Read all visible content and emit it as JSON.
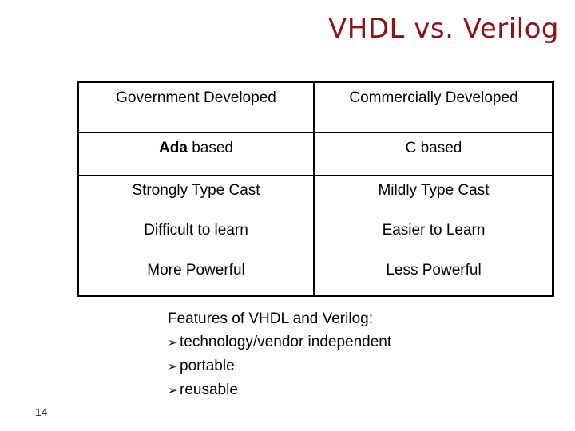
{
  "slide": {
    "title": "VHDL vs. Verilog",
    "title_color": "#8a1518",
    "page_number": "14"
  },
  "table": {
    "rows": [
      {
        "left": "Government Developed",
        "right": "Commercially Developed",
        "left_bold_prefix": "",
        "bold": false
      },
      {
        "left": "Ada based",
        "right": "C based",
        "left_bold_prefix": "Ada",
        "left_rest": " based",
        "bold": true
      },
      {
        "left": "Strongly Type Cast",
        "right": "Mildly Type Cast",
        "bold": false
      },
      {
        "left": "Difficult to learn",
        "right": "Easier to Learn",
        "bold": false
      },
      {
        "left": "More Powerful",
        "right": "Less Powerful",
        "bold": false
      }
    ]
  },
  "features": {
    "heading": "Features of VHDL and Verilog:",
    "bullet_glyph": "➢",
    "items": [
      "technology/vendor independent",
      "portable",
      "reusable"
    ]
  }
}
